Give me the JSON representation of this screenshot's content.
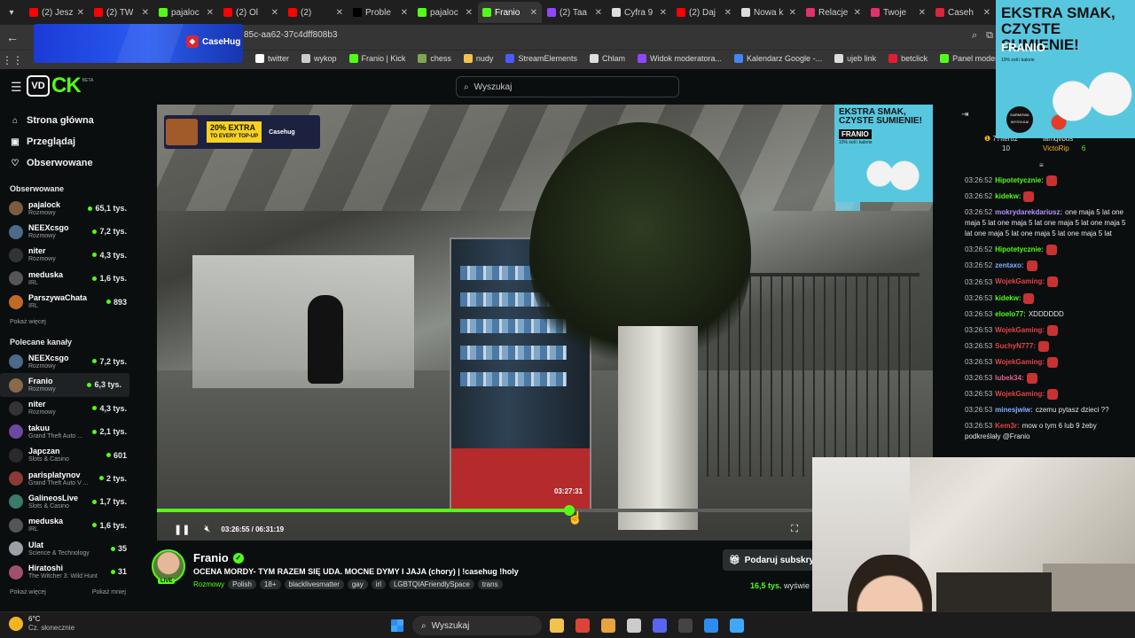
{
  "browser": {
    "tabs": [
      {
        "label": "(2) Jesz",
        "icon": "youtube-icon",
        "color": "#ff0000",
        "active": false
      },
      {
        "label": "(2) TW",
        "icon": "youtube-icon",
        "color": "#ff0000",
        "active": false
      },
      {
        "label": "pajaloc",
        "icon": "kick-icon",
        "color": "#53fc18",
        "active": false
      },
      {
        "label": "(2) Ol",
        "icon": "youtube-icon",
        "color": "#ff0000",
        "active": false
      },
      {
        "label": "(2)",
        "icon": "youtube-icon",
        "color": "#ff0000",
        "active": false
      },
      {
        "label": "Proble",
        "icon": "tiktok-icon",
        "color": "#000000",
        "active": false
      },
      {
        "label": "pajaloc",
        "icon": "kick-icon",
        "color": "#53fc18",
        "active": false
      },
      {
        "label": "Franio",
        "icon": "kick-icon",
        "color": "#53fc18",
        "active": true
      },
      {
        "label": "(2) Taa",
        "icon": "twitch-icon",
        "color": "#9146ff",
        "active": false
      },
      {
        "label": "Cyfra 9",
        "icon": "globe-icon",
        "color": "#dddddd",
        "active": false
      },
      {
        "label": "(2) Daj",
        "icon": "youtube-icon",
        "color": "#ff0000",
        "active": false
      },
      {
        "label": "Nowa k",
        "icon": "globe-icon",
        "color": "#dddddd",
        "active": false
      },
      {
        "label": "Relacje",
        "icon": "instagram-icon",
        "color": "#e1306c",
        "active": false
      },
      {
        "label": "Twoje",
        "icon": "heart-icon",
        "color": "#e1306c",
        "active": false
      },
      {
        "label": "Caseh",
        "icon": "casehug-icon",
        "color": "#d9263a",
        "active": false
      }
    ],
    "url": "85c-aa62-37c4dff808b3",
    "bookmarks": [
      {
        "label": "twitter",
        "icon": "x-icon",
        "color": "#ffffff"
      },
      {
        "label": "wykop",
        "icon": "wykop-icon",
        "color": "#cccccc"
      },
      {
        "label": "Franio | Kick",
        "icon": "kick-icon",
        "color": "#53fc18"
      },
      {
        "label": "chess",
        "icon": "chess-icon",
        "color": "#7fa650"
      },
      {
        "label": "nudy",
        "icon": "folder-icon",
        "color": "#f2c14e"
      },
      {
        "label": "StreamElements",
        "icon": "streamelements-icon",
        "color": "#4b5cff"
      },
      {
        "label": "Chlam",
        "icon": "globe-icon",
        "color": "#dddddd"
      },
      {
        "label": "Widok moderatora...",
        "icon": "twitch-icon",
        "color": "#9146ff"
      },
      {
        "label": "Kalendarz Google -...",
        "icon": "calendar-icon",
        "color": "#4285f4"
      },
      {
        "label": "ujeb link",
        "icon": "globe-icon",
        "color": "#dddddd"
      },
      {
        "label": "betclick",
        "icon": "betclick-icon",
        "color": "#e01e2f"
      },
      {
        "label": "Panel moderatora |...",
        "icon": "kick-icon",
        "color": "#53fc18"
      }
    ]
  },
  "ads": {
    "casehug_banner": "CaseHug",
    "extra_banner": {
      "line1": "20% EXTRA",
      "line2": "TO EVERY TOP-UP",
      "brand": "Casehug"
    },
    "franio_ad": {
      "headline": "EKSTRA SMAK, CZYSTE SUMIENIE!",
      "brand": "FRANIO",
      "sub": "10% soli i kalorie",
      "badge": "DARMOWA WYSYŁKA!"
    }
  },
  "kick": {
    "search_placeholder": "Wyszukaj",
    "nav": [
      {
        "label": "Strona główna",
        "icon": "home-icon"
      },
      {
        "label": "Przeglądaj",
        "icon": "browse-icon"
      },
      {
        "label": "Obserwowane",
        "icon": "heart-icon"
      }
    ],
    "followed_title": "Obserwowane",
    "followed": [
      {
        "name": "pajalock",
        "category": "Rozmowy",
        "viewers": "65,1 tys.",
        "color": "#7a5c40"
      },
      {
        "name": "NEEXcsgo",
        "category": "Rozmowy",
        "viewers": "7,2 tys.",
        "color": "#4a6b8a"
      },
      {
        "name": "niter",
        "category": "Rozmowy",
        "viewers": "4,3 tys.",
        "color": "#333333"
      },
      {
        "name": "meduska",
        "category": "IRL",
        "viewers": "1,6 tys.",
        "color": "#555555"
      },
      {
        "name": "ParszywaChata",
        "category": "IRL",
        "viewers": "893",
        "color": "#c06a28"
      }
    ],
    "show_more": "Pokaż więcej",
    "recommended_title": "Polecane kanały",
    "recommended": [
      {
        "name": "NEEXcsgo",
        "category": "Rozmowy",
        "viewers": "7,2 tys.",
        "color": "#4a6b8a",
        "selected": false
      },
      {
        "name": "Franio",
        "category": "Rozmowy",
        "viewers": "6,3 tys.",
        "color": "#8a6a4a",
        "selected": true
      },
      {
        "name": "niter",
        "category": "Rozmowy",
        "viewers": "4,3 tys.",
        "color": "#333333",
        "selected": false
      },
      {
        "name": "takuu",
        "category": "Grand Theft Auto ...",
        "viewers": "2,1 tys.",
        "color": "#6a4aa0",
        "selected": false
      },
      {
        "name": "Japczan",
        "category": "Slots & Casino",
        "viewers": "601",
        "color": "#2a2a2a",
        "selected": false
      },
      {
        "name": "parisplatynov",
        "category": "Grand Theft Auto V ...",
        "viewers": "2 tys.",
        "color": "#8a3a3a",
        "selected": false
      },
      {
        "name": "GalineosLive",
        "category": "Slots & Casino",
        "viewers": "1,7 tys.",
        "color": "#3a7a6a",
        "selected": false
      },
      {
        "name": "meduska",
        "category": "IRL",
        "viewers": "1,6 tys.",
        "color": "#555555",
        "selected": false
      },
      {
        "name": "Ulat",
        "category": "Science & Technology",
        "viewers": "35",
        "color": "#9aa0a6",
        "selected": false
      },
      {
        "name": "Hiratoshi",
        "category": "The Witcher 3: Wild Hunt",
        "viewers": "31",
        "color": "#a0506a",
        "selected": false
      }
    ],
    "show_more2": "Pokaż więcej",
    "show_less": "Pokaż mniej"
  },
  "player": {
    "hover_time": "03:27:31",
    "timecode": "03:26:55 / 06:31:19",
    "progress": 0.531
  },
  "stream": {
    "streamer": "Franio",
    "title": "OCENA MORDY- TYM RAZEM SIĘ UDA. MOCNE DYMY I JAJA (chory) | !casehug !holy",
    "category": "Rozmowy",
    "tags": [
      "Polish",
      "18+",
      "blacklivesmatter",
      "gay",
      "irl",
      "LGBTQIAFriendlySpace",
      "trans"
    ],
    "live_label": "LIVE",
    "subscribe_label": "Podaruj subskryp",
    "viewers_count": "16,5 tys.",
    "viewers_label": "wyświe"
  },
  "chat": {
    "leaderboard": [
      {
        "name": "77iteruz",
        "count": "10"
      },
      {
        "name": "lamqvbus",
        "count": ""
      },
      {
        "name": "VictoRip",
        "count": "6"
      }
    ],
    "messages": [
      {
        "time": "03:26:52",
        "user": "Hipotetycznie:",
        "color": "#53fc18",
        "text": ""
      },
      {
        "time": "03:26:52",
        "user": "kidekw:",
        "color": "#53fc18",
        "text": ""
      },
      {
        "time": "03:26:52",
        "user": "mokrydarekdariusz:",
        "color": "#b690ff",
        "text": "one maja 5 lat one maja 5 lat one maja 5 lat one maja 5 lat one maja 5 lat one maja 5 lat one maja 5 lat one maja 5 lat"
      },
      {
        "time": "03:26:52",
        "user": "Hipotetycznie:",
        "color": "#53fc18",
        "text": ""
      },
      {
        "time": "03:26:52",
        "user": "zentaxo:",
        "color": "#7fb0ff",
        "text": ""
      },
      {
        "time": "03:26:53",
        "user": "WojekGaming:",
        "color": "#e04444",
        "text": ""
      },
      {
        "time": "03:26:53",
        "user": "kidekw:",
        "color": "#53fc18",
        "text": ""
      },
      {
        "time": "03:26:53",
        "user": "eloelo77:",
        "color": "#53fc18",
        "text": "XDDDDDD"
      },
      {
        "time": "03:26:53",
        "user": "WojekGaming:",
        "color": "#e04444",
        "text": ""
      },
      {
        "time": "03:26:53",
        "user": "SuchyN777:",
        "color": "#e04444",
        "text": ""
      },
      {
        "time": "03:26:53",
        "user": "WojekGaming:",
        "color": "#e04444",
        "text": ""
      },
      {
        "time": "03:26:53",
        "user": "lubek34:",
        "color": "#e06090",
        "text": ""
      },
      {
        "time": "03:26:53",
        "user": "WojekGaming:",
        "color": "#e04444",
        "text": ""
      },
      {
        "time": "03:26:53",
        "user": "minesjwiw:",
        "color": "#7fb0ff",
        "text": "czemu pytasz dzieci ??"
      },
      {
        "time": "03:26:53",
        "user": "Kem3r:",
        "color": "#e04444",
        "text": "mow o tym 6 lub 9 żeby podkreślały @Franio"
      }
    ]
  },
  "taskbar": {
    "temp": "6°C",
    "weather": "Cz. słonecznie",
    "search": "Wyszukaj",
    "apps": [
      {
        "name": "file-explorer-icon",
        "color": "#f2c14e"
      },
      {
        "name": "chrome-icon",
        "color": "#db4437"
      },
      {
        "name": "app-icon",
        "color": "#e8a33d"
      },
      {
        "name": "app2-icon",
        "color": "#cccccc"
      },
      {
        "name": "discord-icon",
        "color": "#5865f2"
      },
      {
        "name": "terminal-icon",
        "color": "#444444"
      },
      {
        "name": "notepad-icon",
        "color": "#2d8cf0"
      },
      {
        "name": "globe-icon",
        "color": "#3ea8ff"
      }
    ]
  }
}
